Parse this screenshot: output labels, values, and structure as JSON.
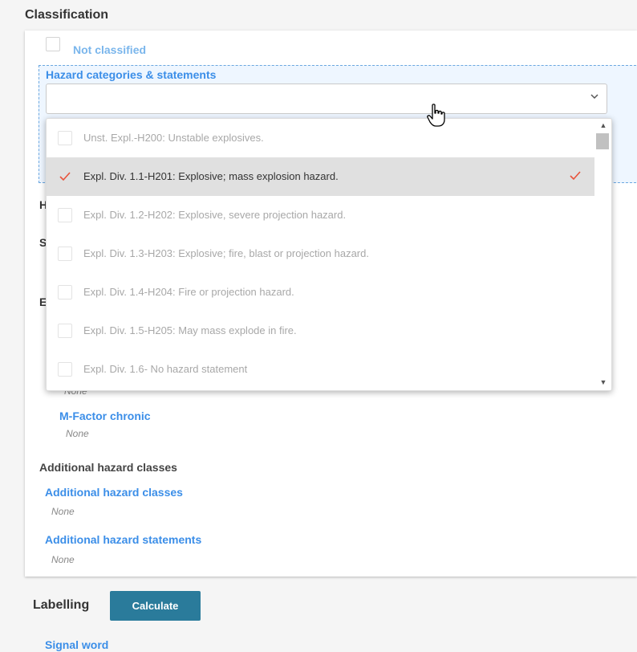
{
  "section": {
    "title": "Classification"
  },
  "not_classified": {
    "label": "Not classified"
  },
  "hazard": {
    "label": "Hazard categories & statements",
    "select_value": ""
  },
  "dropdown": {
    "options": [
      {
        "label": "Unst. Expl.-H200: Unstable explosives.",
        "selected": false
      },
      {
        "label": "Expl. Div. 1.1-H201: Explosive; mass explosion hazard.",
        "selected": true
      },
      {
        "label": "Expl. Div. 1.2-H202: Explosive, severe projection hazard.",
        "selected": false
      },
      {
        "label": "Expl. Div. 1.3-H203: Explosive; fire, blast or projection hazard.",
        "selected": false
      },
      {
        "label": "Expl. Div. 1.4-H204: Fire or projection hazard.",
        "selected": false
      },
      {
        "label": "Expl. Div. 1.5-H205: May mass explode in fire.",
        "selected": false
      },
      {
        "label": "Expl. Div. 1.6- No hazard statement",
        "selected": false
      }
    ]
  },
  "peek": {
    "h": "H",
    "s": "S",
    "e": "E",
    "none_partial": "None"
  },
  "m_factor_chronic": {
    "label": "M-Factor chronic",
    "value": "None"
  },
  "additional": {
    "heading": "Additional hazard classes",
    "classes_label": "Additional hazard classes",
    "classes_value": "None",
    "statements_label": "Additional hazard statements",
    "statements_value": "None"
  },
  "labelling": {
    "title": "Labelling",
    "calculate_label": "Calculate"
  },
  "signal_word": {
    "label": "Signal word"
  },
  "colors": {
    "accent": "#3b8ee8",
    "button": "#2a7b9b",
    "check": "#e8533b"
  },
  "icons": {
    "chevron": "chevron-down-icon",
    "cursor": "hand-pointer-icon",
    "check": "checkmark-icon"
  }
}
